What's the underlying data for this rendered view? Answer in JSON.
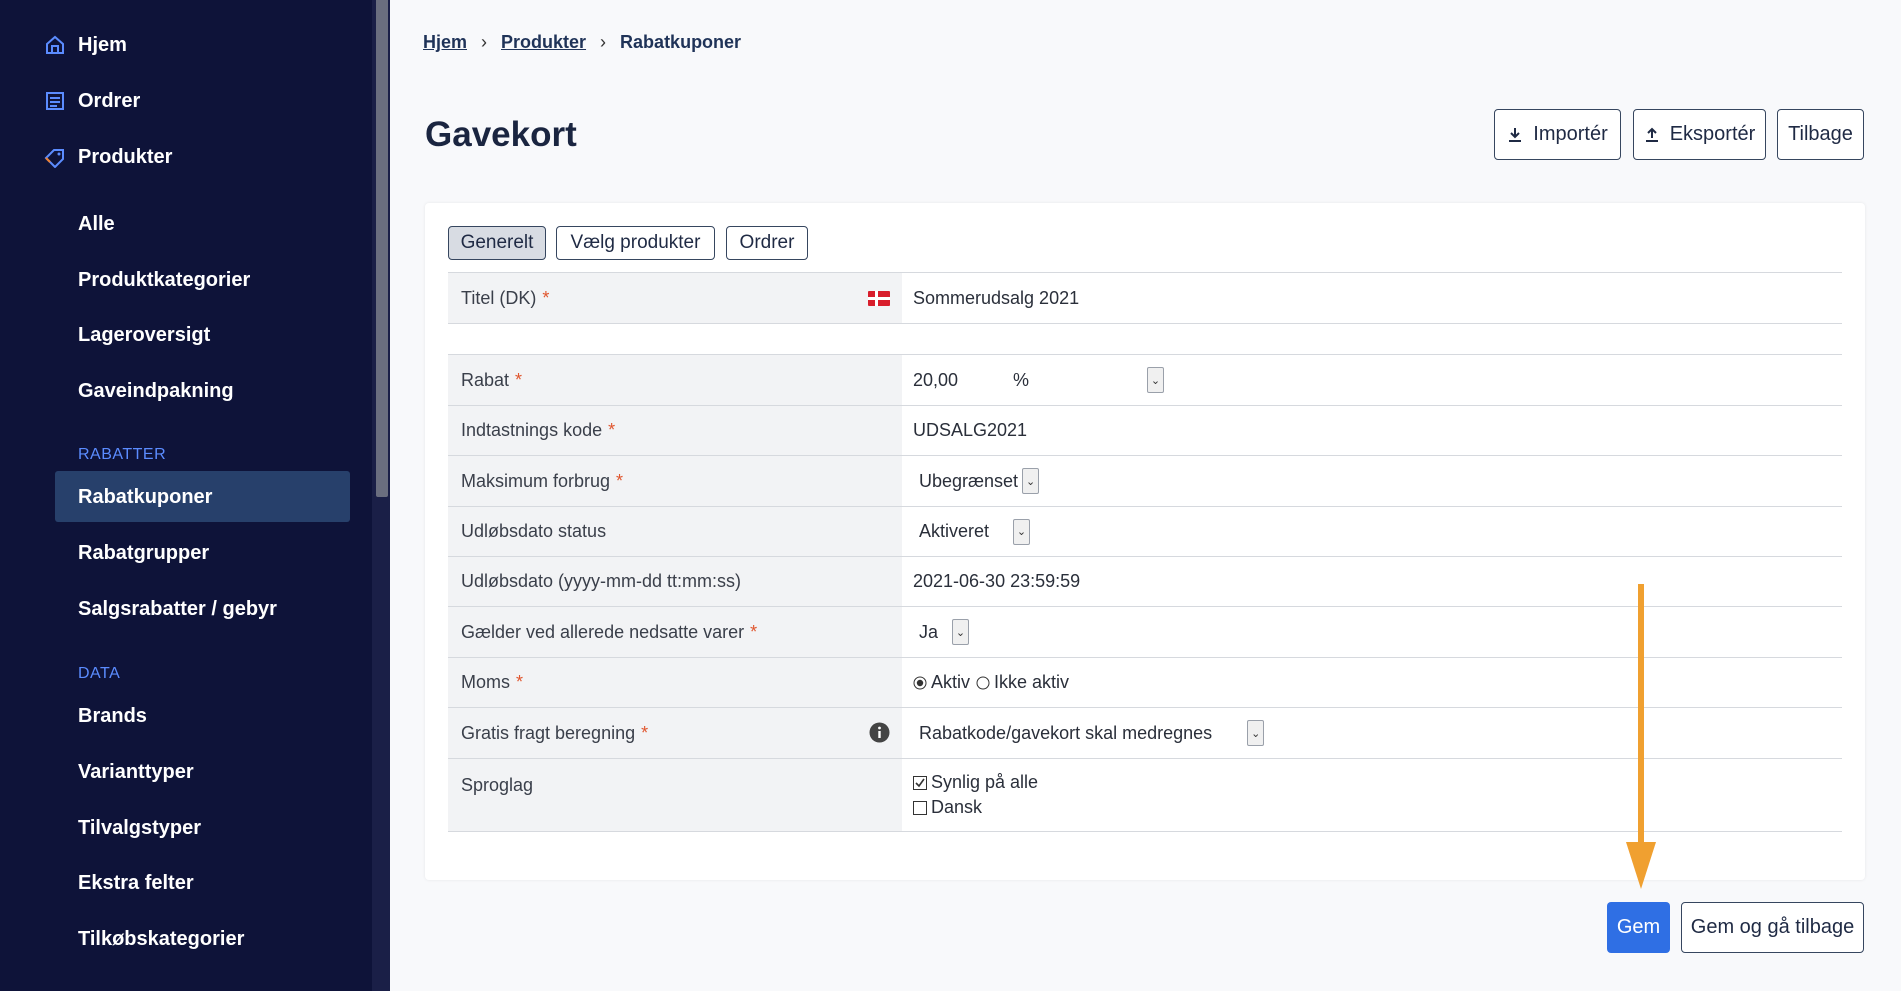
{
  "sidebar": {
    "main": [
      {
        "label": "Hjem",
        "icon": "home-icon"
      },
      {
        "label": "Ordrer",
        "icon": "orders-icon"
      },
      {
        "label": "Produkter",
        "icon": "tag-icon"
      }
    ],
    "produkter_items": [
      "Alle",
      "Produktkategorier",
      "Lageroversigt",
      "Gaveindpakning"
    ],
    "rabatter_label": "RABATTER",
    "rabatter_items": [
      "Rabatkuponer",
      "Rabatgrupper",
      "Salgsrabatter / gebyr"
    ],
    "data_label": "DATA",
    "data_items": [
      "Brands",
      "Varianttyper",
      "Tilvalgstyper",
      "Ekstra felter",
      "Tilkøbskategorier"
    ],
    "active_item": "Rabatkuponer"
  },
  "breadcrumb": [
    "Hjem",
    "Produkter",
    "Rabatkuponer"
  ],
  "page_title": "Gavekort",
  "header_buttons": {
    "import": "Importér",
    "export": "Eksportér",
    "back": "Tilbage"
  },
  "tabs": [
    "Generelt",
    "Vælg produkter",
    "Ordrer"
  ],
  "form": {
    "title_label": "Titel (DK)",
    "title_value": "Sommerudsalg 2021",
    "rabat_label": "Rabat",
    "rabat_value": "20,00",
    "rabat_unit": "%",
    "kode_label": "Indtastnings kode",
    "kode_value": "UDSALG2021",
    "forbrug_label": "Maksimum forbrug",
    "forbrug_value": "Ubegrænset",
    "udlob_status_label": "Udløbsdato status",
    "udlob_status_value": "Aktiveret",
    "udlob_label": "Udløbsdato (yyyy-mm-dd tt:mm:ss)",
    "udlob_value": "2021-06-30 23:59:59",
    "nedsatte_label": "Gælder ved allerede nedsatte varer",
    "nedsatte_value": "Ja",
    "moms_label": "Moms",
    "moms_option_1": "Aktiv",
    "moms_option_2": "Ikke aktiv",
    "fragt_label": "Gratis fragt beregning",
    "fragt_value": "Rabatkode/gavekort skal medregnes",
    "sprog_label": "Sproglag",
    "sprog_option_1": "Synlig på alle",
    "sprog_option_2": "Dansk"
  },
  "footer_buttons": {
    "save": "Gem",
    "save_back": "Gem og gå tilbage"
  },
  "colors": {
    "sidebar_bg": "#0e1339",
    "accent": "#2f6fe4",
    "annotation_arrow": "#f0a030",
    "required": "#e0552d"
  }
}
